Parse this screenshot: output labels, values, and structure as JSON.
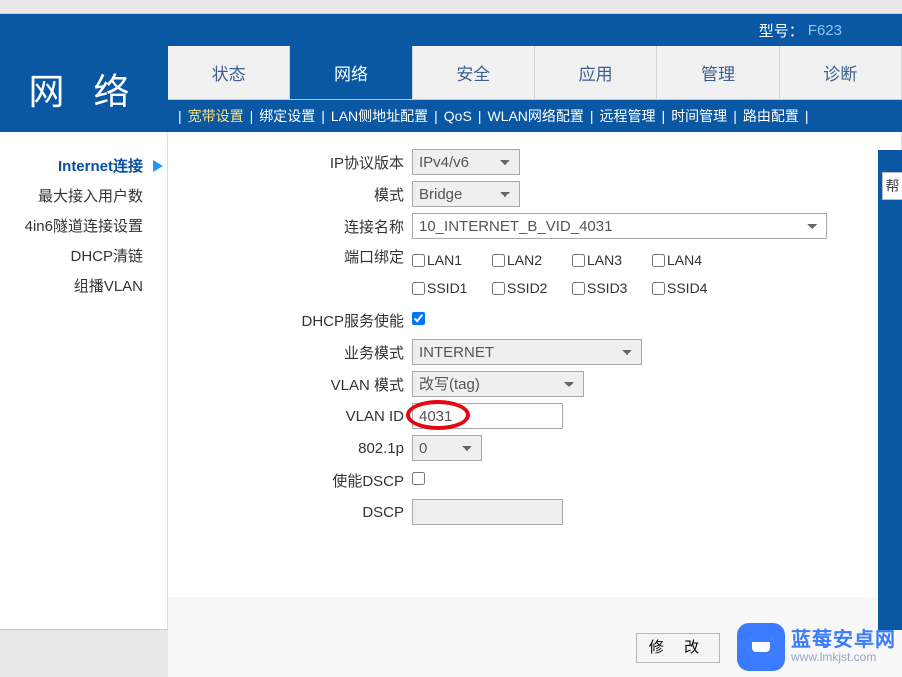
{
  "model_bar": {
    "label": "型号：",
    "value": "F623"
  },
  "logo": "网 络",
  "tabs": [
    "状态",
    "网络",
    "安全",
    "应用",
    "管理",
    "诊断"
  ],
  "active_tab_index": 1,
  "submenu": [
    "宽带设置",
    "绑定设置",
    "LAN侧地址配置",
    "QoS",
    "WLAN网络配置",
    "远程管理",
    "时间管理",
    "路由配置"
  ],
  "active_submenu_index": 0,
  "sidebar": [
    "Internet连接",
    "最大接入用户数",
    "4in6隧道连接设置",
    "DHCP清链",
    "组播VLAN"
  ],
  "active_sidebar_index": 0,
  "form": {
    "ip_version": {
      "label": "IP协议版本",
      "value": "IPv4/v6"
    },
    "mode": {
      "label": "模式",
      "value": "Bridge"
    },
    "conn_name": {
      "label": "连接名称",
      "value": "10_INTERNET_B_VID_4031"
    },
    "port_bind": {
      "label": "端口绑定",
      "ports": [
        "LAN1",
        "LAN2",
        "LAN3",
        "LAN4",
        "SSID1",
        "SSID2",
        "SSID3",
        "SSID4"
      ]
    },
    "dhcp_enable": {
      "label": "DHCP服务使能",
      "checked": true
    },
    "biz_mode": {
      "label": "业务模式",
      "value": "INTERNET"
    },
    "vlan_mode": {
      "label": "VLAN 模式",
      "value": "改写(tag)"
    },
    "vlan_id": {
      "label": "VLAN ID",
      "value": "4031"
    },
    "p8021": {
      "label": "802.1p",
      "value": "0"
    },
    "dscp_enable": {
      "label": "使能DSCP",
      "checked": false
    },
    "dscp": {
      "label": "DSCP",
      "value": ""
    }
  },
  "buttons": {
    "modify": "修 改"
  },
  "help_tab": "帮",
  "watermark": {
    "title": "蓝莓安卓网",
    "url": "www.lmkjst.com"
  }
}
